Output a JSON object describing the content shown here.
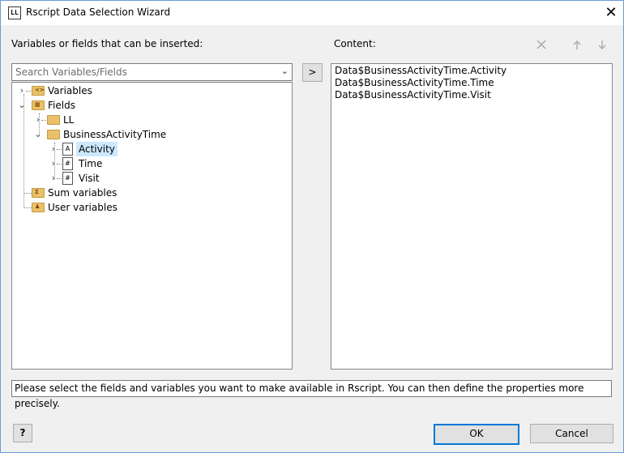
{
  "window": {
    "title": "Rscript Data Selection Wizard",
    "app_icon": "LL",
    "close_glyph": "✕"
  },
  "left_panel": {
    "label": "Variables or fields that can be inserted:",
    "search_placeholder": "Search Variables/Fields",
    "tree": [
      {
        "label": "Variables",
        "icon": "variables-folder-icon",
        "expanded": false
      },
      {
        "label": "Fields",
        "icon": "fields-folder-icon",
        "expanded": true
      },
      {
        "label": "LL",
        "icon": "folder-icon",
        "expanded": false
      },
      {
        "label": "BusinessActivityTime",
        "icon": "folder-icon",
        "expanded": true
      },
      {
        "label": "Activity",
        "icon": "text-field-icon",
        "selected": true
      },
      {
        "label": "Time",
        "icon": "numeric-field-icon"
      },
      {
        "label": "Visit",
        "icon": "numeric-field-icon"
      },
      {
        "label": "Sum variables",
        "icon": "sum-variables-icon"
      },
      {
        "label": "User variables",
        "icon": "user-variables-icon"
      }
    ]
  },
  "move_button_label": ">",
  "right_panel": {
    "label": "Content:",
    "items": [
      "Data$BusinessActivityTime.Activity",
      "Data$BusinessActivityTime.Time",
      "Data$BusinessActivityTime.Visit"
    ]
  },
  "status_text": "Please select the fields and variables you want to make available in Rscript. You can then define the properties more precisely.",
  "buttons": {
    "help": "?",
    "ok": "OK",
    "cancel": "Cancel"
  }
}
